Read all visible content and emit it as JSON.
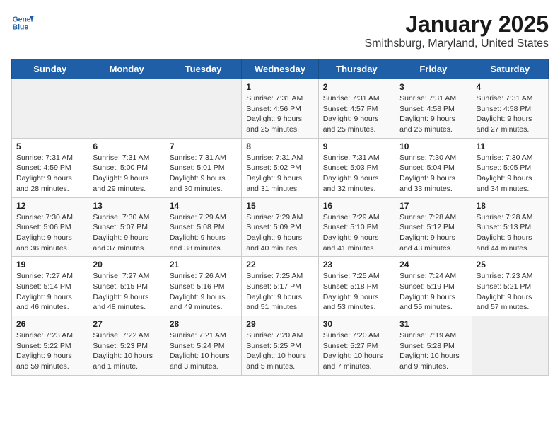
{
  "header": {
    "logo_line1": "General",
    "logo_line2": "Blue",
    "month": "January 2025",
    "location": "Smithsburg, Maryland, United States"
  },
  "weekdays": [
    "Sunday",
    "Monday",
    "Tuesday",
    "Wednesday",
    "Thursday",
    "Friday",
    "Saturday"
  ],
  "weeks": [
    [
      {
        "day": "",
        "info": ""
      },
      {
        "day": "",
        "info": ""
      },
      {
        "day": "",
        "info": ""
      },
      {
        "day": "1",
        "info": "Sunrise: 7:31 AM\nSunset: 4:56 PM\nDaylight: 9 hours\nand 25 minutes."
      },
      {
        "day": "2",
        "info": "Sunrise: 7:31 AM\nSunset: 4:57 PM\nDaylight: 9 hours\nand 25 minutes."
      },
      {
        "day": "3",
        "info": "Sunrise: 7:31 AM\nSunset: 4:58 PM\nDaylight: 9 hours\nand 26 minutes."
      },
      {
        "day": "4",
        "info": "Sunrise: 7:31 AM\nSunset: 4:58 PM\nDaylight: 9 hours\nand 27 minutes."
      }
    ],
    [
      {
        "day": "5",
        "info": "Sunrise: 7:31 AM\nSunset: 4:59 PM\nDaylight: 9 hours\nand 28 minutes."
      },
      {
        "day": "6",
        "info": "Sunrise: 7:31 AM\nSunset: 5:00 PM\nDaylight: 9 hours\nand 29 minutes."
      },
      {
        "day": "7",
        "info": "Sunrise: 7:31 AM\nSunset: 5:01 PM\nDaylight: 9 hours\nand 30 minutes."
      },
      {
        "day": "8",
        "info": "Sunrise: 7:31 AM\nSunset: 5:02 PM\nDaylight: 9 hours\nand 31 minutes."
      },
      {
        "day": "9",
        "info": "Sunrise: 7:31 AM\nSunset: 5:03 PM\nDaylight: 9 hours\nand 32 minutes."
      },
      {
        "day": "10",
        "info": "Sunrise: 7:30 AM\nSunset: 5:04 PM\nDaylight: 9 hours\nand 33 minutes."
      },
      {
        "day": "11",
        "info": "Sunrise: 7:30 AM\nSunset: 5:05 PM\nDaylight: 9 hours\nand 34 minutes."
      }
    ],
    [
      {
        "day": "12",
        "info": "Sunrise: 7:30 AM\nSunset: 5:06 PM\nDaylight: 9 hours\nand 36 minutes."
      },
      {
        "day": "13",
        "info": "Sunrise: 7:30 AM\nSunset: 5:07 PM\nDaylight: 9 hours\nand 37 minutes."
      },
      {
        "day": "14",
        "info": "Sunrise: 7:29 AM\nSunset: 5:08 PM\nDaylight: 9 hours\nand 38 minutes."
      },
      {
        "day": "15",
        "info": "Sunrise: 7:29 AM\nSunset: 5:09 PM\nDaylight: 9 hours\nand 40 minutes."
      },
      {
        "day": "16",
        "info": "Sunrise: 7:29 AM\nSunset: 5:10 PM\nDaylight: 9 hours\nand 41 minutes."
      },
      {
        "day": "17",
        "info": "Sunrise: 7:28 AM\nSunset: 5:12 PM\nDaylight: 9 hours\nand 43 minutes."
      },
      {
        "day": "18",
        "info": "Sunrise: 7:28 AM\nSunset: 5:13 PM\nDaylight: 9 hours\nand 44 minutes."
      }
    ],
    [
      {
        "day": "19",
        "info": "Sunrise: 7:27 AM\nSunset: 5:14 PM\nDaylight: 9 hours\nand 46 minutes."
      },
      {
        "day": "20",
        "info": "Sunrise: 7:27 AM\nSunset: 5:15 PM\nDaylight: 9 hours\nand 48 minutes."
      },
      {
        "day": "21",
        "info": "Sunrise: 7:26 AM\nSunset: 5:16 PM\nDaylight: 9 hours\nand 49 minutes."
      },
      {
        "day": "22",
        "info": "Sunrise: 7:25 AM\nSunset: 5:17 PM\nDaylight: 9 hours\nand 51 minutes."
      },
      {
        "day": "23",
        "info": "Sunrise: 7:25 AM\nSunset: 5:18 PM\nDaylight: 9 hours\nand 53 minutes."
      },
      {
        "day": "24",
        "info": "Sunrise: 7:24 AM\nSunset: 5:19 PM\nDaylight: 9 hours\nand 55 minutes."
      },
      {
        "day": "25",
        "info": "Sunrise: 7:23 AM\nSunset: 5:21 PM\nDaylight: 9 hours\nand 57 minutes."
      }
    ],
    [
      {
        "day": "26",
        "info": "Sunrise: 7:23 AM\nSunset: 5:22 PM\nDaylight: 9 hours\nand 59 minutes."
      },
      {
        "day": "27",
        "info": "Sunrise: 7:22 AM\nSunset: 5:23 PM\nDaylight: 10 hours\nand 1 minute."
      },
      {
        "day": "28",
        "info": "Sunrise: 7:21 AM\nSunset: 5:24 PM\nDaylight: 10 hours\nand 3 minutes."
      },
      {
        "day": "29",
        "info": "Sunrise: 7:20 AM\nSunset: 5:25 PM\nDaylight: 10 hours\nand 5 minutes."
      },
      {
        "day": "30",
        "info": "Sunrise: 7:20 AM\nSunset: 5:27 PM\nDaylight: 10 hours\nand 7 minutes."
      },
      {
        "day": "31",
        "info": "Sunrise: 7:19 AM\nSunset: 5:28 PM\nDaylight: 10 hours\nand 9 minutes."
      },
      {
        "day": "",
        "info": ""
      }
    ]
  ]
}
